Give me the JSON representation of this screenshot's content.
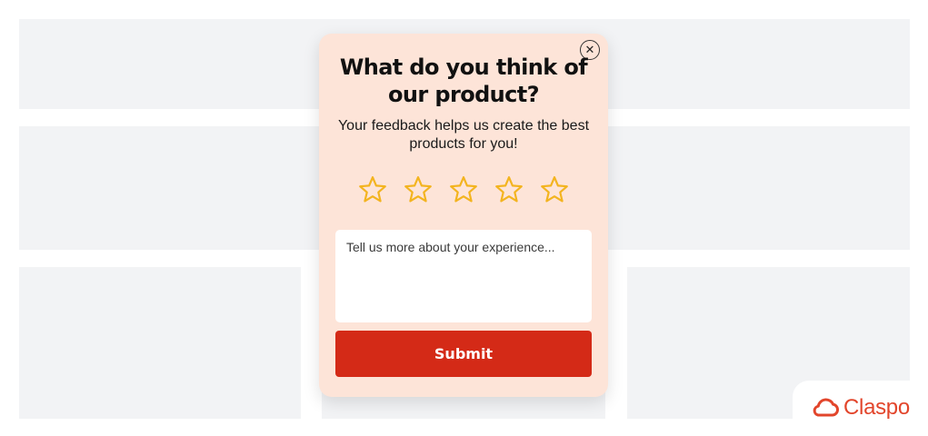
{
  "popup": {
    "title": "What do you think of our product?",
    "subtitle": "Your feedback helps us create the best products for you!",
    "close_label": "✕",
    "rating": {
      "max": 5,
      "selected": 0,
      "star_color": "#f3b41f"
    },
    "feedback": {
      "placeholder": "Tell us more about your experience...",
      "value": ""
    },
    "submit_label": "Submit",
    "background_color": "#fde4d8",
    "submit_color": "#d42a17"
  },
  "brand": {
    "name": "Claspo",
    "icon": "cloud-logo-icon",
    "color": "#e2452b"
  }
}
